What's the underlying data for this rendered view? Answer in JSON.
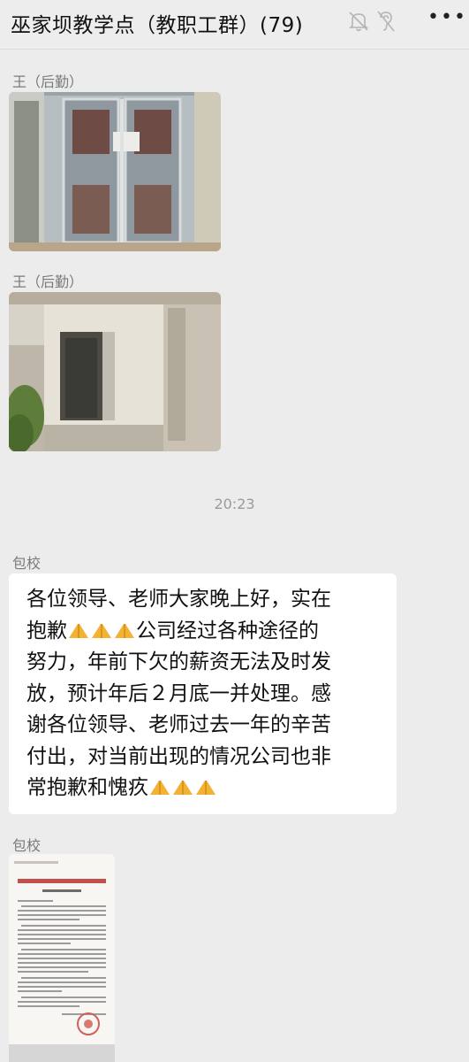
{
  "header": {
    "title": "巫家坝教学点（教职工群）(79)",
    "more_label": "•••",
    "icons": [
      "bell-muted-icon",
      "ear-icon",
      "more-icon"
    ]
  },
  "messages": [
    {
      "sender": "王（后勤）",
      "type": "image",
      "depicts": "gate-photo"
    },
    {
      "sender": "王（后勤）",
      "type": "image",
      "depicts": "doorway-photo"
    },
    {
      "time": "20:23"
    },
    {
      "sender": "包校",
      "type": "text",
      "lines": [
        "各位领导、老师大家晚上好，实在",
        "公司经过各种途径的",
        "努力，年前下欠的薪资无法及时发",
        "放，预计年后２月底一并处理。感",
        "谢各位领导、老师过去一年的辛苦",
        "付出，对当前出现的情况公司也非",
        "常抱歉和愧疚"
      ],
      "line2_prefix": "抱歉",
      "emoji": "pray-icon"
    },
    {
      "sender": "包校",
      "type": "document-image"
    }
  ],
  "colors": {
    "background": "#ececec",
    "bubble": "#ffffff",
    "muted_text": "#7a7a7a"
  }
}
